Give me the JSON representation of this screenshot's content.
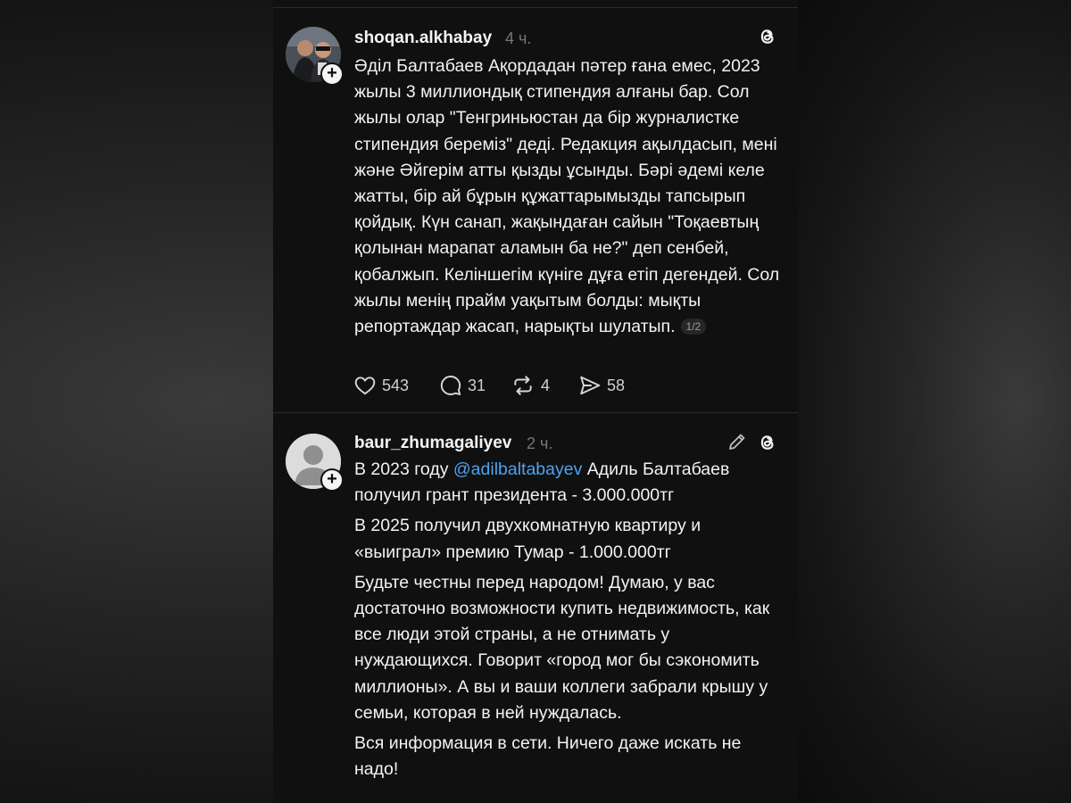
{
  "posts": [
    {
      "username": "shoqan.alkhabay",
      "time": "4 ч.",
      "text": "Әділ Балтабаев Ақордадан пәтер ғана емес, 2023 жылы 3 миллиондық стипендия алғаны бар. Сол жылы олар \"Тенгриньюстан да бір журналистке стипендия береміз\" деді. Редакция ақылдасып, мені және Әйгерім атты қызды ұсынды. Бәрі әдемі келе жатты, бір ай бұрын құжаттарымызды тапсырып қойдық. Күн санап, жақындаған сайын \"Тоқаевтың қолынан марапат аламын ба не?\" деп сенбей, қобалжып. Келіншегім күніге дұға етіп дегендей. Сол жылы менің прайм уақытым болды: мықты репортаждар жасап, нарықты шулатып.",
      "page": "1/2",
      "likes": "543",
      "replies": "31",
      "reposts": "4",
      "shares": "58"
    },
    {
      "username": "baur_zhumagaliyev",
      "time": "2 ч.",
      "line1_pre": "В 2023 году ",
      "mention": "@adilbaltabayev",
      "line1_post": " Адиль Балтабаев получил грант президента - 3.000.000тг",
      "para2": "В 2025 получил двухкомнатную квартиру и «выиграл» премию Тумар - 1.000.000тг",
      "para3": "Будьте честны перед народом! Думаю, у вас достаточно возможности купить недвижимость, как все люди этой страны, а не отнимать у нуждающихся. Говорит «город мог бы сэкономить миллионы». А вы и ваши коллеги забрали крышу у семьи, которая в ней нуждалась.",
      "para4": "Вся информация в сети. Ничего даже искать не надо!"
    }
  ],
  "icons": {
    "threads": "threads-logo-icon",
    "plus": "+",
    "like": "heart-icon",
    "reply": "speech-bubble-icon",
    "repost": "repost-arrows-icon",
    "share": "paper-plane-icon",
    "edit": "pencil-icon"
  },
  "colors": {
    "background": "#101010",
    "mention": "#4ea2f0",
    "muted": "#777777"
  }
}
